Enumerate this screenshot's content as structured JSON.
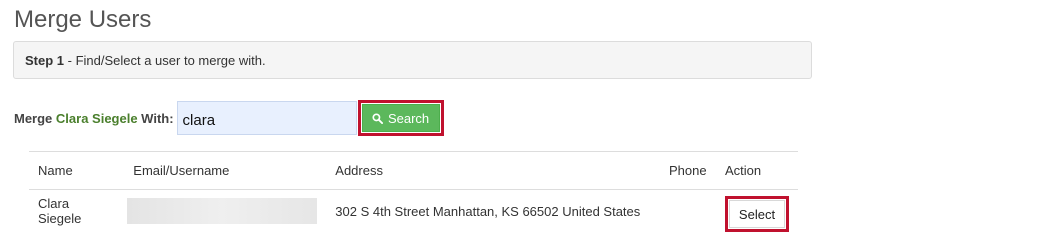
{
  "page": {
    "title": "Merge Users"
  },
  "step": {
    "number_label": "Step 1",
    "description": " - Find/Select a user to merge with."
  },
  "merge": {
    "label_prefix": "Merge ",
    "user_name": "Clara Siegele",
    "label_suffix": " With:",
    "search_value": "clara",
    "search_button_label": "Search"
  },
  "table": {
    "headers": [
      "Name",
      "Email/Username",
      "Address",
      "Phone",
      "Action"
    ],
    "rows": [
      {
        "name": "Clara Siegele",
        "address": "302 S 4th Street Manhattan, KS 66502 United States",
        "phone": "",
        "action_label": "Select"
      }
    ]
  },
  "colors": {
    "success": "#5cb85c",
    "highlight": "#c0112e",
    "user_name": "#4a7f2c"
  }
}
